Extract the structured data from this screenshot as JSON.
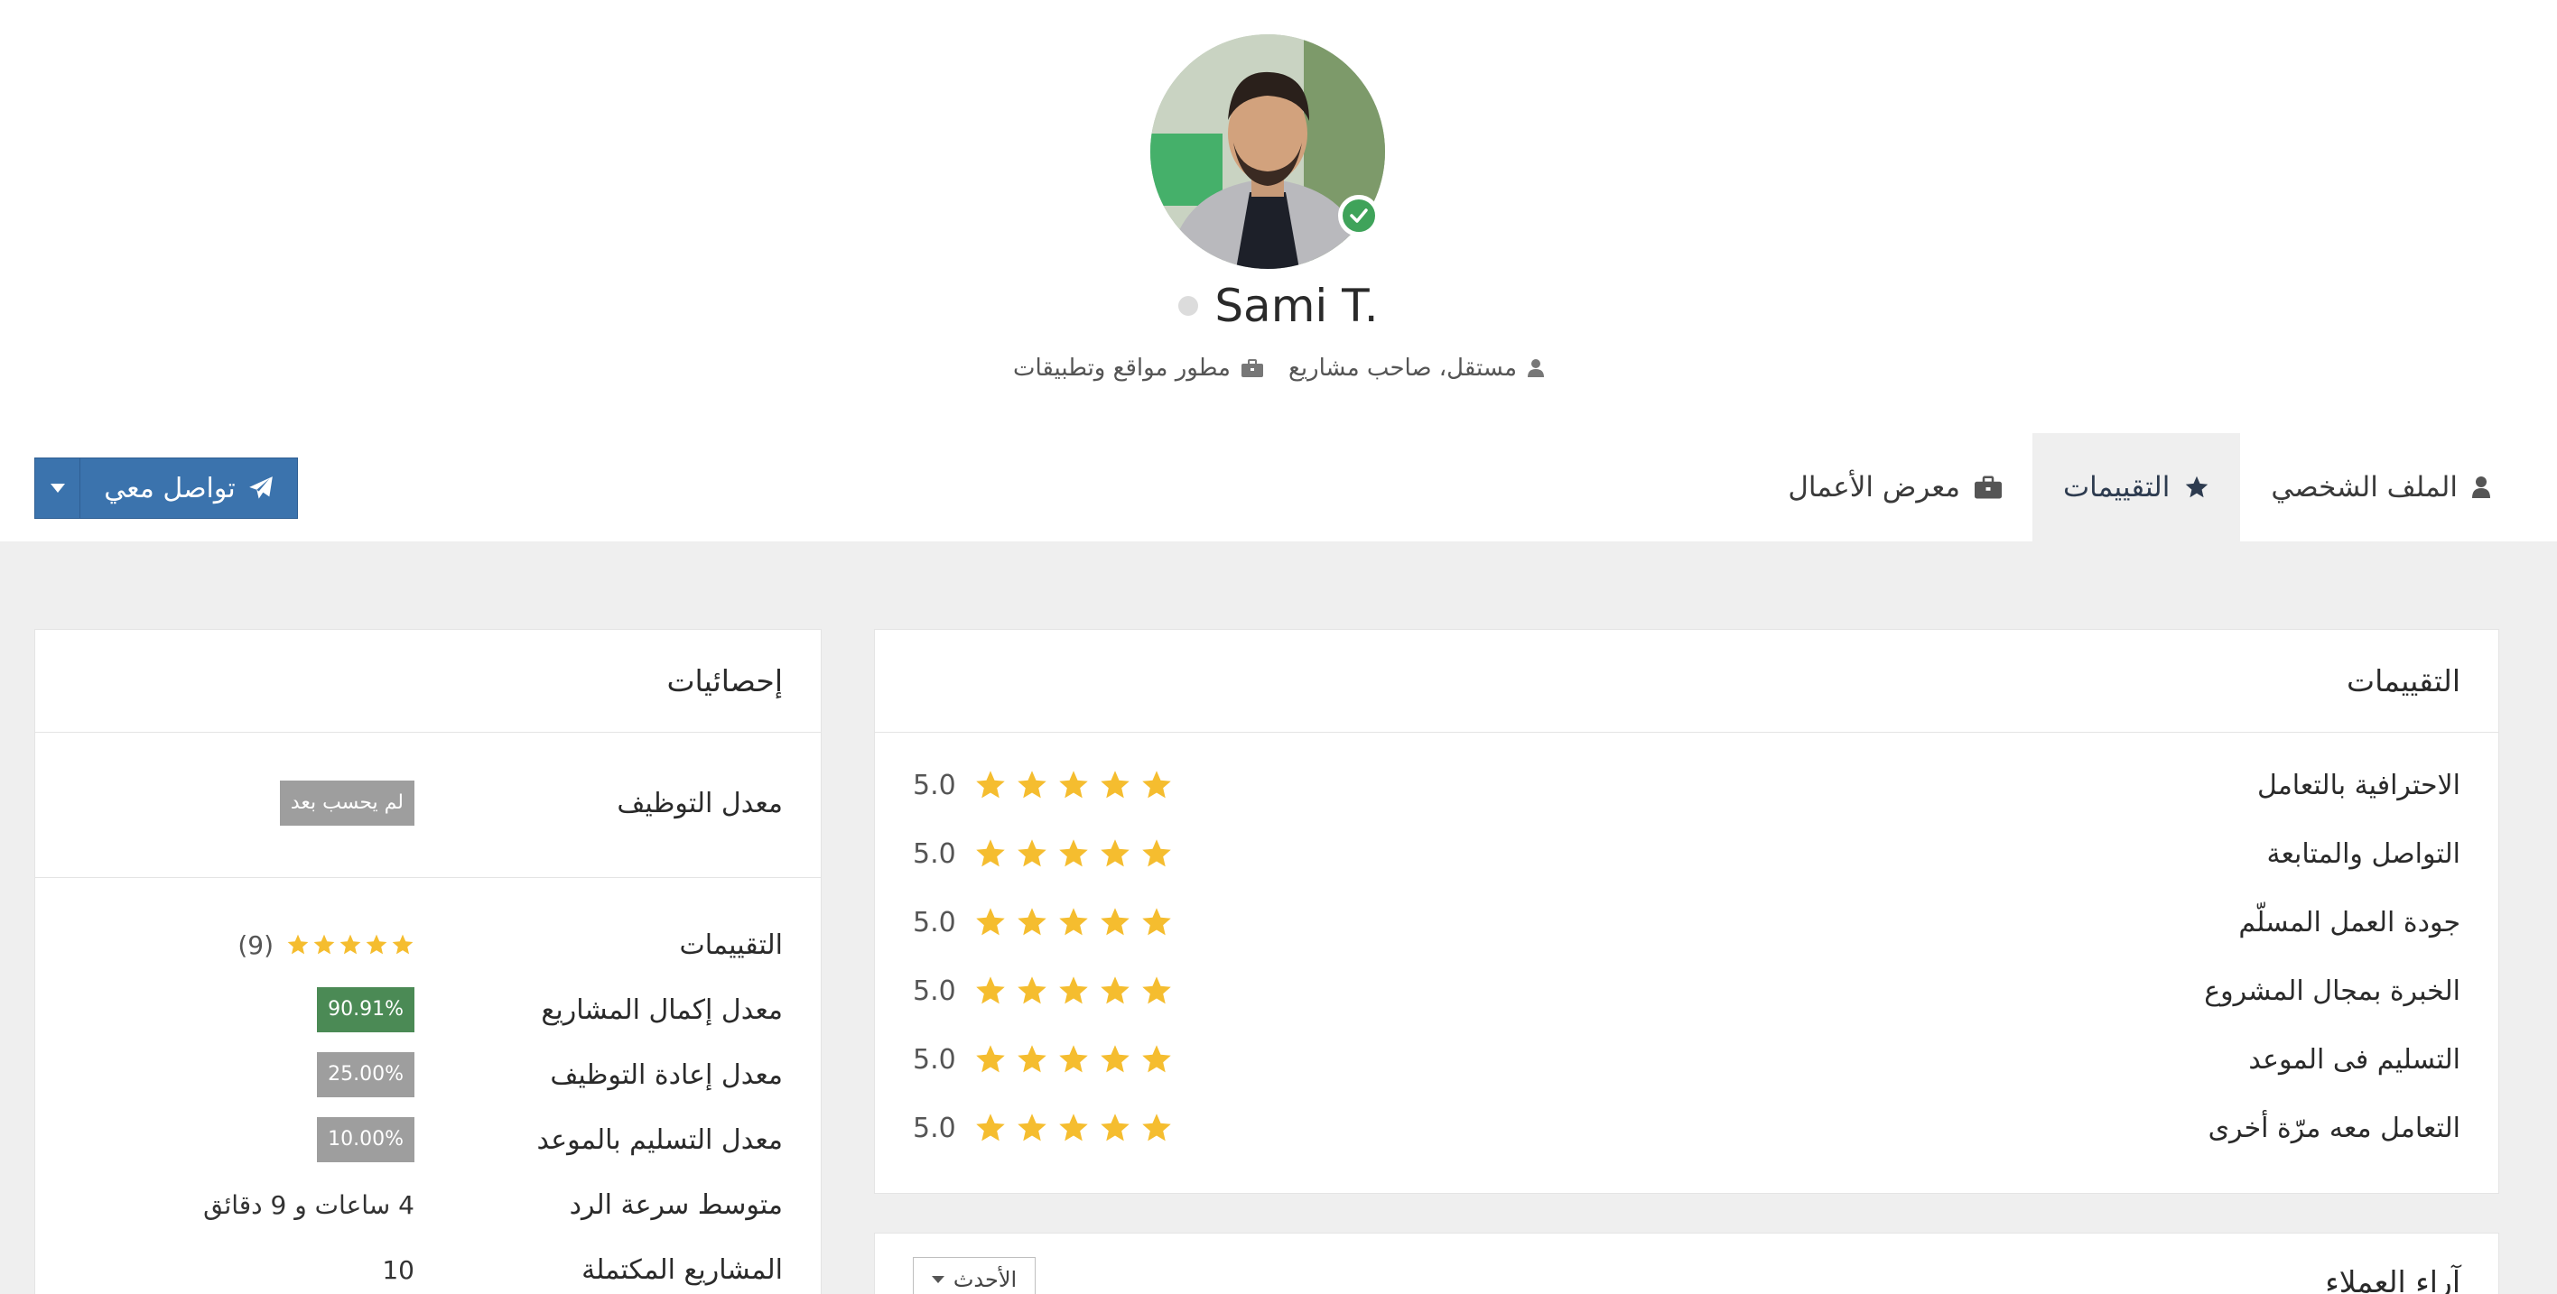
{
  "profile": {
    "name": "Sami T.",
    "role": "مستقل، صاحب مشاريع",
    "title": "مطور مواقع وتطبيقات",
    "verified": true,
    "online": false
  },
  "tabs": [
    {
      "label": "الملف الشخصي",
      "icon": "user-icon",
      "active": false
    },
    {
      "label": "التقييمات",
      "icon": "star-icon",
      "active": true
    },
    {
      "label": "معرض الأعمال",
      "icon": "briefcase-icon",
      "active": false
    }
  ],
  "contact_button": {
    "label": "تواصل معي",
    "icon": "paper-plane-icon"
  },
  "ratings_card": {
    "title": "التقييمات",
    "items": [
      {
        "label": "الاحترافية بالتعامل",
        "stars": 5,
        "value": "5.0"
      },
      {
        "label": "التواصل والمتابعة",
        "stars": 5,
        "value": "5.0"
      },
      {
        "label": "جودة العمل المسلّم",
        "stars": 5,
        "value": "5.0"
      },
      {
        "label": "الخبرة بمجال المشروع",
        "stars": 5,
        "value": "5.0"
      },
      {
        "label": "التسليم فى الموعد",
        "stars": 5,
        "value": "5.0"
      },
      {
        "label": "التعامل معه مرّة أخرى",
        "stars": 5,
        "value": "5.0"
      }
    ]
  },
  "reviews_card": {
    "title": "آراء العملاء",
    "sort_label": "الأحدث"
  },
  "stats_card": {
    "title": "إحصائيات",
    "hiring_rate": {
      "label": "معدل التوظيف",
      "value": "لم يحسب بعد"
    },
    "ratings": {
      "label": "التقييمات",
      "stars": 5,
      "count": "(9)"
    },
    "completion": {
      "label": "معدل إكمال المشاريع",
      "value": "90.91%"
    },
    "rehire": {
      "label": "معدل إعادة التوظيف",
      "value": "25.00%"
    },
    "on_time": {
      "label": "معدل التسليم بالموعد",
      "value": "10.00%"
    },
    "response": {
      "label": "متوسط سرعة الرد",
      "value": "4 ساعات و 9 دقائق"
    },
    "completed": {
      "label": "المشاريع المكتملة",
      "value": "10"
    }
  },
  "colors": {
    "accent": "#3b73ad",
    "star": "#f5bd2f",
    "verified": "#3fa35a",
    "badge_green": "#4b8a55",
    "badge_gray": "#9e9e9e"
  }
}
